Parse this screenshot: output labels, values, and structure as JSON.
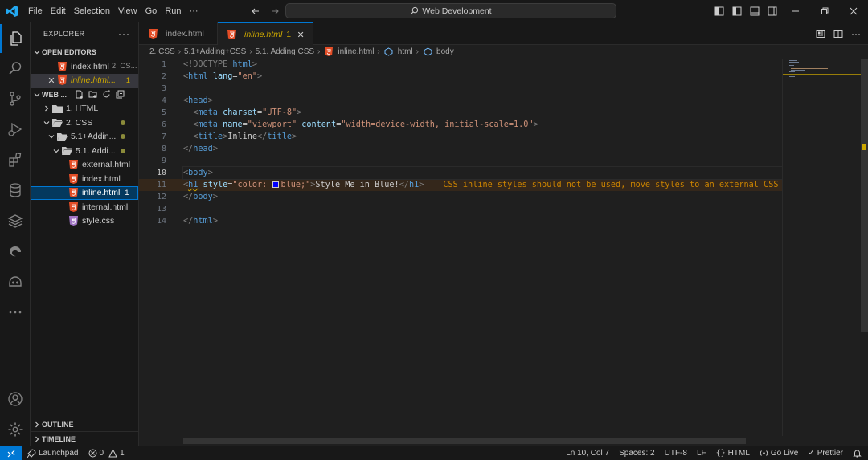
{
  "menu": [
    "File",
    "Edit",
    "Selection",
    "View",
    "Go",
    "Run",
    "···"
  ],
  "command_center": "Web Development",
  "explorer": {
    "title": "EXPLORER",
    "open_editors_label": "OPEN EDITORS",
    "open_editors": [
      {
        "name": "index.html",
        "detail": "2. CS..."
      },
      {
        "name": "inline.html...",
        "badge": "1"
      }
    ],
    "workspace_label": "WEB ...",
    "tree": [
      {
        "label": "1. HTML"
      },
      {
        "label": "2. CSS"
      },
      {
        "label": "5.1+Addin..."
      },
      {
        "label": "5.1. Addi..."
      },
      {
        "label": "external.html"
      },
      {
        "label": "index.html"
      },
      {
        "label": "inline.html",
        "badge": "1"
      },
      {
        "label": "internal.html"
      },
      {
        "label": "style.css"
      }
    ],
    "outline_label": "OUTLINE",
    "timeline_label": "TIMELINE"
  },
  "tabs": [
    {
      "label": "index.html"
    },
    {
      "label": "inline.html",
      "badge": "1"
    }
  ],
  "breadcrumb": [
    "2. CSS",
    "5.1+Adding+CSS",
    "5.1. Adding CSS",
    "inline.html",
    "html",
    "body"
  ],
  "editor": {
    "line_numbers": [
      "1",
      "2",
      "3",
      "4",
      "5",
      "6",
      "7",
      "8",
      "9",
      "10",
      "11",
      "12",
      "13",
      "14"
    ],
    "code": {
      "l1_a": "<!DOCTYPE",
      "l1_b": " html",
      "l1_c": ">",
      "l2_a": "<",
      "l2_b": "html",
      "l2_c": " lang",
      "l2_d": "=",
      "l2_e": "\"en\"",
      "l2_f": ">",
      "l4_a": "<",
      "l4_b": "head",
      "l4_c": ">",
      "l5_a": "  <",
      "l5_b": "meta",
      "l5_c": " charset",
      "l5_d": "=",
      "l5_e": "\"UTF-8\"",
      "l5_f": ">",
      "l6_a": "  <",
      "l6_b": "meta",
      "l6_c": " name",
      "l6_d": "=",
      "l6_e": "\"viewport\"",
      "l6_f": " content",
      "l6_g": "=",
      "l6_h": "\"width=device-width, initial-scale=1.0\"",
      "l6_i": ">",
      "l7_a": "  <",
      "l7_b": "title",
      "l7_c": ">",
      "l7_d": "Inline",
      "l7_e": "</",
      "l7_f": "title",
      "l7_g": ">",
      "l8_a": "</",
      "l8_b": "head",
      "l8_c": ">",
      "l10_a": "<",
      "l10_b": "body",
      "l10_c": ">",
      "l11_a": "<",
      "l11_b": "h1",
      "l11_c": " style",
      "l11_d": "=",
      "l11_e": "\"color: ",
      "l11_f": "blue;\"",
      "l11_g": ">",
      "l11_h": "Style Me in Blue!",
      "l11_i": "</",
      "l11_j": "h1",
      "l11_k": ">",
      "l12_a": "</",
      "l12_b": "body",
      "l12_c": ">",
      "l14_a": "</",
      "l14_b": "html",
      "l14_c": ">"
    },
    "inline_warning": "CSS inline styles should not be used, move styles to an external CSS"
  },
  "status": {
    "launchpad": "Launchpad",
    "errors": "0",
    "warnings": "1",
    "position": "Ln 10, Col 7",
    "spaces": "Spaces: 2",
    "encoding": "UTF-8",
    "eol": "LF",
    "language": "HTML",
    "golive": "Go Live",
    "prettier": "Prettier"
  },
  "colors": {
    "accent": "#0078d4",
    "warning": "#cca700",
    "html_icon": "#e44d26",
    "css_icon": "#a074c4"
  }
}
